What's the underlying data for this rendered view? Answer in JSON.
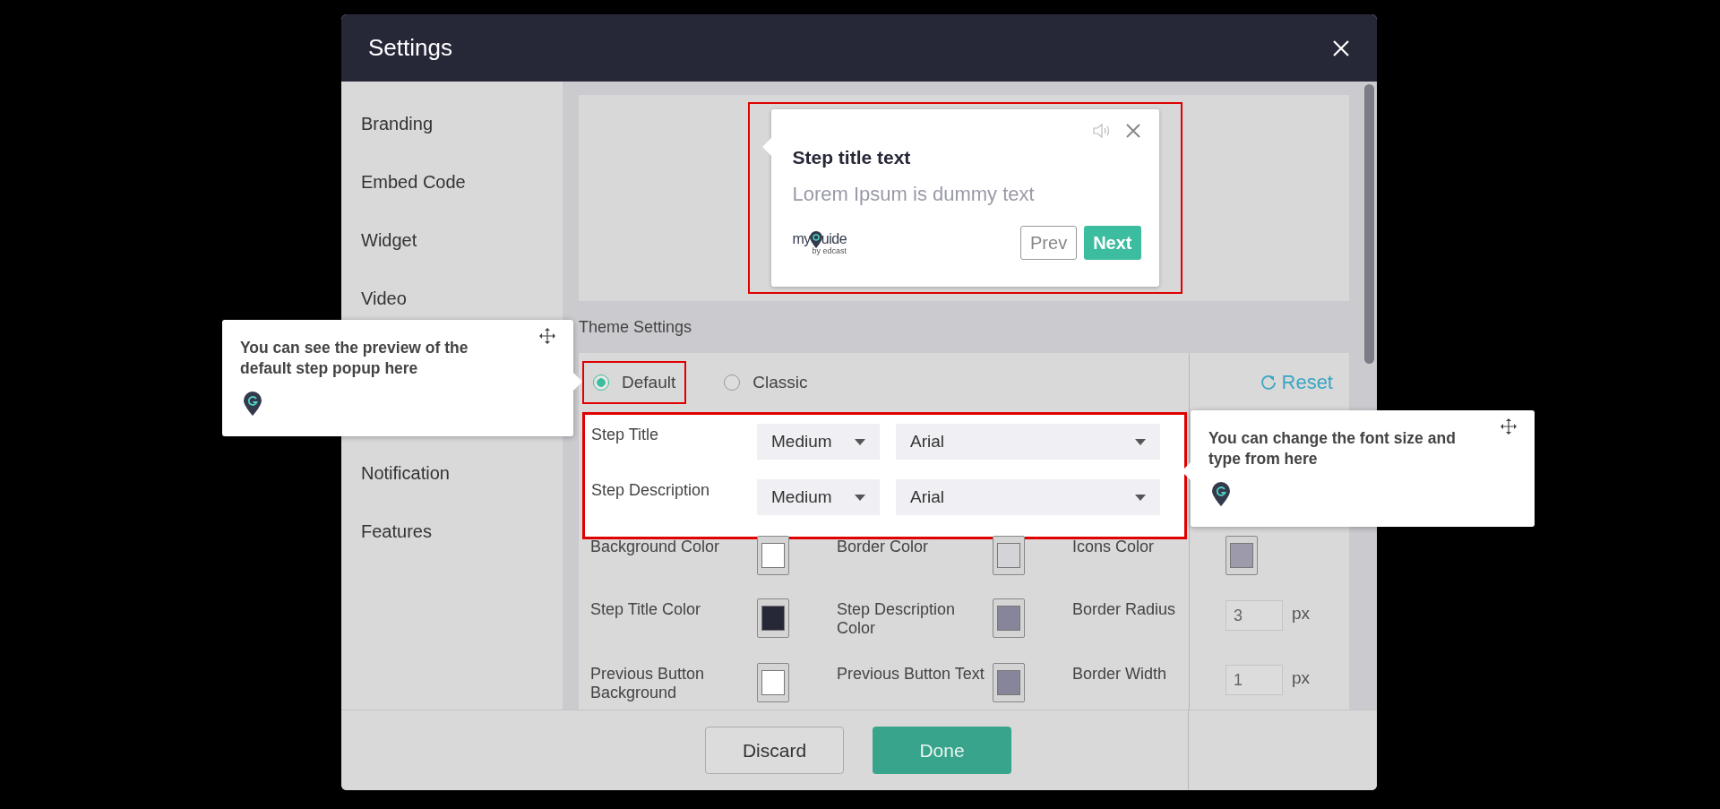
{
  "window": {
    "title": "Settings"
  },
  "sidebar": {
    "items": [
      {
        "label": "Branding"
      },
      {
        "label": "Embed Code"
      },
      {
        "label": "Widget"
      },
      {
        "label": "Video"
      },
      {
        "label": "Notification"
      },
      {
        "label": "Features"
      }
    ]
  },
  "preview": {
    "title": "Step title text",
    "description": "Lorem Ipsum is dummy text",
    "logo": "my",
    "logo_tail": "uide",
    "logo_sub": "by edcast",
    "buttons": [
      {
        "label": "Prev",
        "kind": "secondary"
      },
      {
        "label": "Next",
        "kind": "primary"
      }
    ]
  },
  "theme_settings": {
    "title": "Theme Settings",
    "reset": "Reset",
    "themes": [
      {
        "label": "Default",
        "selected": true
      },
      {
        "label": "Classic",
        "selected": false
      }
    ],
    "fonts": [
      {
        "label": "Step Title",
        "size": "Medium",
        "family": "Arial"
      },
      {
        "label": "Step Description",
        "size": "Medium",
        "family": "Arial"
      }
    ],
    "options": [
      {
        "label": "Background Color",
        "kind": "color",
        "color": "#ffffff"
      },
      {
        "label": "Border Color",
        "kind": "color",
        "color": "#d4d4d8"
      },
      {
        "label": "Icons Color",
        "kind": "color",
        "color": "#9c9aab"
      },
      {
        "label": "Step Title Color",
        "kind": "color",
        "color": "#262838"
      },
      {
        "label": "Step Description Color",
        "kind": "color",
        "color": "#86859a"
      },
      {
        "label": "Border Radius",
        "kind": "number",
        "value": "3",
        "unit": "px"
      },
      {
        "label": "Previous Button Background",
        "kind": "color",
        "color": "#ffffff"
      },
      {
        "label": "Previous Button Text",
        "kind": "color",
        "color": "#86859a"
      },
      {
        "label": "Border Width",
        "kind": "number",
        "value": "1",
        "unit": "px"
      }
    ]
  },
  "footer": {
    "buttons": [
      {
        "label": "Discard",
        "kind": "secondary"
      },
      {
        "label": "Done",
        "kind": "primary"
      }
    ]
  },
  "tooltips": [
    {
      "text": "You can see the preview of the default step popup here"
    },
    {
      "text": "You can change the font size and type from here"
    }
  ]
}
